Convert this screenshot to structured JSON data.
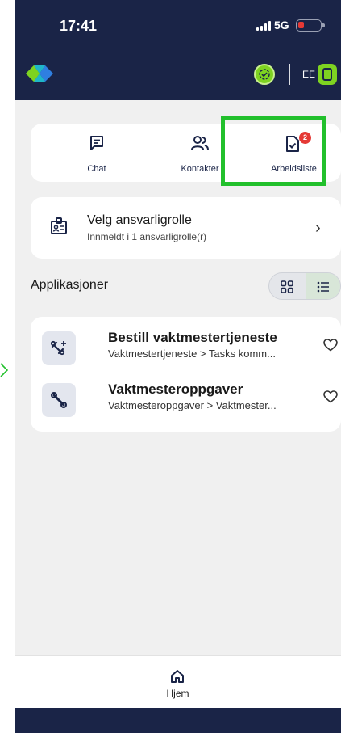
{
  "status_bar": {
    "time": "17:41",
    "network": "5G"
  },
  "app_bar": {
    "initials": "EE"
  },
  "quick_actions": {
    "chat": "Chat",
    "contacts": "Kontakter",
    "worklist": "Arbeidsliste",
    "worklist_badge": "2"
  },
  "role_card": {
    "title": "Velg ansvarligrolle",
    "subtitle": "Innmeldt i 1 ansvarligrolle(r)",
    "chevron": "›"
  },
  "applications": {
    "title": "Applikasjoner",
    "items": [
      {
        "title": "Bestill vaktmestertjeneste",
        "subtitle": "Vaktmestertjeneste > Tasks komm..."
      },
      {
        "title": "Vaktmesteroppgaver",
        "subtitle": "Vaktmesteroppgaver > Vaktmester..."
      }
    ]
  },
  "bottom_nav": {
    "home": "Hjem"
  },
  "colors": {
    "navy": "#1a2447",
    "accent_green": "#7ed321",
    "highlight_green": "#22c02c",
    "badge_red": "#e53935"
  },
  "icons": [
    "cell-signal-icon",
    "battery-icon",
    "diamond-logo-icon",
    "status-check-icon",
    "device-icon",
    "chat-icon",
    "contacts-icon",
    "worklist-icon",
    "id-card-icon",
    "chevron-right-icon",
    "grid-view-icon",
    "list-view-icon",
    "wrench-plus-icon",
    "wrench-icon",
    "heart-icon",
    "home-icon"
  ]
}
